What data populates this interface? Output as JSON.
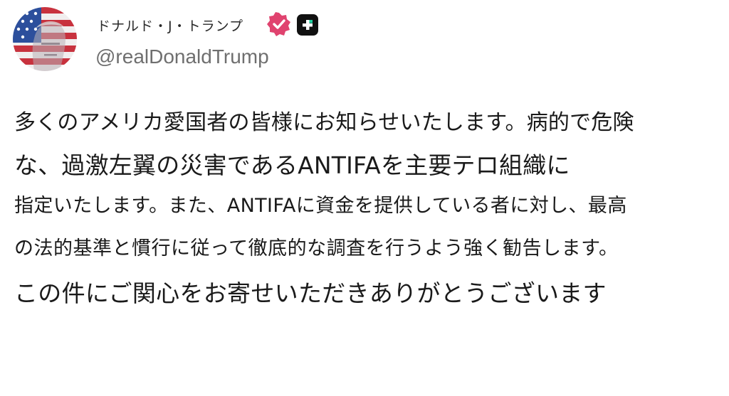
{
  "post": {
    "author": {
      "display_name": "ドナルド・J・トランプ",
      "handle": "@realDonaldTrump",
      "avatar_icon": "portrait-flag-avatar-icon",
      "verified_icon": "verified-badge-icon",
      "plus_icon": "plus-badge-icon",
      "verified_color": "#e0436f"
    },
    "body_lines": [
      "多くのアメリカ愛国者の皆様にお知らせいたします。病的で危険",
      "な、過激左翼の災害であるANTIFAを主要テロ組織に",
      "指定いたします。また、ANTIFAに資金を提供している者に対し、最高",
      "の法的基準と慣行に従って徹底的な調査を行うよう強く勧告します。",
      "この件にご関心をお寄せいただきありがとうございます"
    ]
  }
}
